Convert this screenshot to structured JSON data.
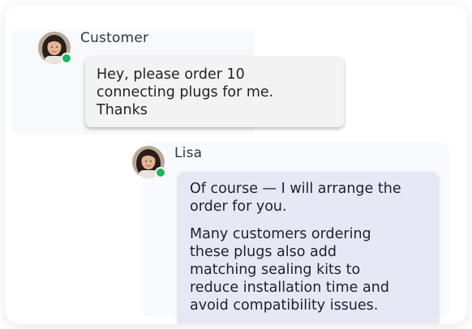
{
  "messages": [
    {
      "sender": "Customer",
      "status": "online",
      "avatar_icon": "woman-avatar-icon",
      "lines": [
        "Hey, please order 10",
        "connecting plugs for me.",
        "Thanks"
      ]
    },
    {
      "sender": "Lisa",
      "status": "online",
      "avatar_icon": "woman-avatar-icon",
      "paragraph_1": [
        "Of course — I will arrange the",
        "order for you."
      ],
      "paragraph_2": [
        "Many customers ordering",
        "these plugs also add",
        "matching sealing kits to",
        "reduce installation time and",
        "avoid compatibility issues."
      ]
    }
  ],
  "colors": {
    "status_online": "#22b35e",
    "customer_bubble": "#f3f3f4",
    "agent_bubble": "#e7e8f6"
  }
}
